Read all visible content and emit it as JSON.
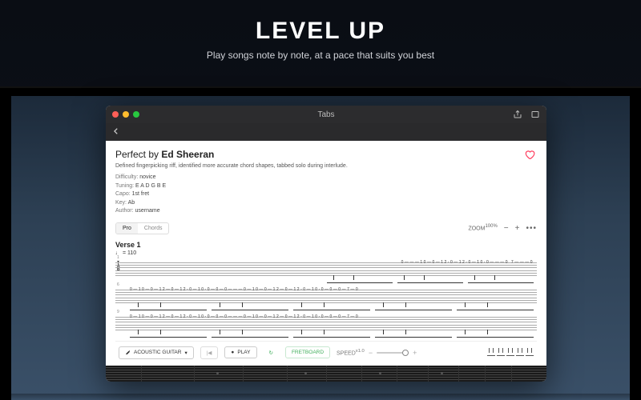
{
  "hero": {
    "title": "LEVEL UP",
    "subtitle": "Play songs note by note, at a pace that suits you best"
  },
  "window": {
    "title": "Tabs"
  },
  "song": {
    "title_prefix": "Perfect by ",
    "artist": "Ed Sheeran",
    "description": "Defined fingerpicking riff, identified more accurate chord shapes, tabbed solo during interlude.",
    "difficulty_label": "Difficulty:",
    "difficulty": "novice",
    "tuning_label": "Tuning:",
    "tuning": "E A D G B E",
    "capo_label": "Capo:",
    "capo": "1st fret",
    "key_label": "Key:",
    "key": "Ab",
    "author_label": "Author:",
    "author": "username"
  },
  "viewtabs": {
    "pro": "Pro",
    "chords": "Chords"
  },
  "zoom": {
    "label": "ZOOM",
    "value": "100%",
    "minus": "−",
    "plus": "+",
    "more": "•••"
  },
  "section": {
    "name": "Verse 1",
    "tempo": "♩ = 110"
  },
  "tab": {
    "clef": "T\nA\nB",
    "row1_bar": "1",
    "row1_notes": "0———10—0—12-0—12-0—10-0———0 7———0",
    "row2_bar": "6",
    "row2_notes": "0—10—0—12—0—12-0—10-0—0—0———0—10—0—12—0—12-0—10-0—0—0—7—0",
    "row3_bar": "9",
    "row3_notes": "0—10—0—12—0—12-0—10-0—0—0———0—10—0—12—0—12-0—10-0—0—0—7—0"
  },
  "player": {
    "instrument": "ACOUSTIC GUITAR",
    "prev": "|◀",
    "play": "PLAY",
    "loop": "↻",
    "fretboard": "FRETBOARD",
    "speed_label": "SPEED",
    "speed_value": "x1.0"
  }
}
